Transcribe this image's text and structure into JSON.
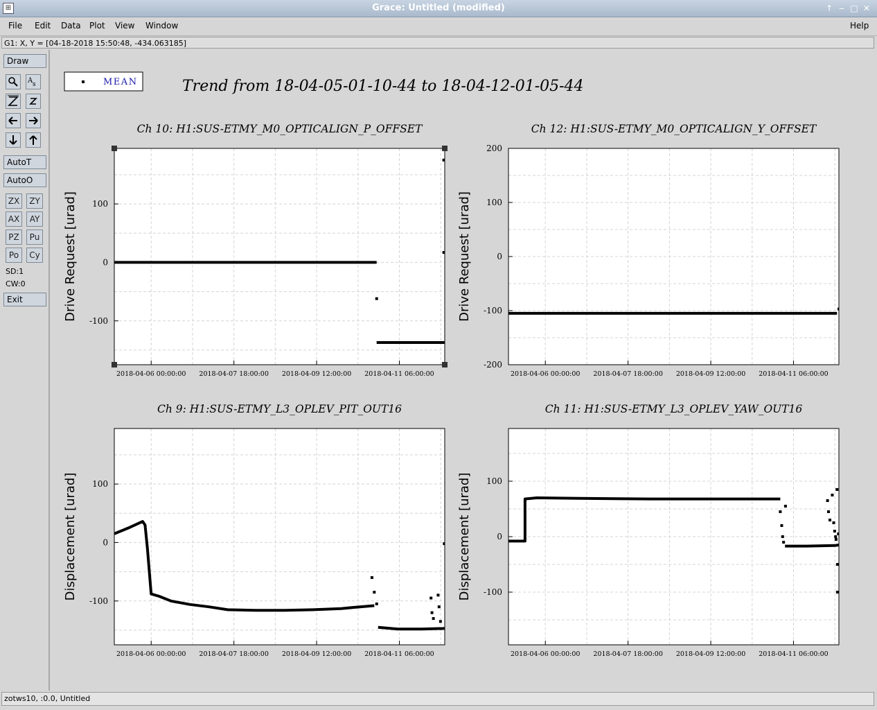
{
  "window": {
    "title": "Grace: Untitled (modified)"
  },
  "menubar": {
    "file": "File",
    "edit": "Edit",
    "data": "Data",
    "plot": "Plot",
    "view": "View",
    "window": "Window",
    "help": "Help"
  },
  "coord_readout": "G1: X, Y = [04-18-2018 15:50:48, -434.063185]",
  "toolbar": {
    "draw": "Draw",
    "autot": "AutoT",
    "autoo": "AutoO",
    "zx": "ZX",
    "zy": "ZY",
    "ax": "AX",
    "ay": "AY",
    "pz": "PZ",
    "pu": "Pu",
    "po": "Po",
    "cy": "Cy",
    "sd": "SD:1",
    "cw": "CW:0",
    "exit": "Exit"
  },
  "status": "zotws10, :0.0, Untitled",
  "legend": {
    "label": "MEAN"
  },
  "main_title": "Trend from 18-04-05-01-10-44 to 18-04-12-01-05-44",
  "chart_data": [
    {
      "type": "line",
      "title": "Ch 10: H1:SUS-ETMY_M0_OPTICALIGN_P_OFFSET",
      "ylabel": "Drive Request [urad]",
      "xticks": [
        "2018-04-06 00:00:00",
        "2018-04-07 18:00:00",
        "2018-04-09 12:00:00",
        "2018-04-11 06:00:00"
      ],
      "yticks": [
        -100,
        0,
        100
      ],
      "ylim": [
        -175,
        195
      ],
      "xlim": [
        0,
        6.99
      ],
      "x_unit": "days since 2018-04-05 01:10:44",
      "series": [
        {
          "name": "MEAN",
          "segments": [
            [
              [
                0,
                0
              ],
              [
                5.55,
                0
              ]
            ],
            [
              [
                5.55,
                -137
              ],
              [
                6.99,
                -137
              ]
            ]
          ],
          "points": [
            [
              5.55,
              -62
            ],
            [
              6.97,
              175
            ],
            [
              6.97,
              17
            ]
          ]
        }
      ]
    },
    {
      "type": "line",
      "title": "Ch 12: H1:SUS-ETMY_M0_OPTICALIGN_Y_OFFSET",
      "ylabel": "Drive Request [urad]",
      "xticks": [
        "2018-04-06 00:00:00",
        "2018-04-07 18:00:00",
        "2018-04-09 12:00:00",
        "2018-04-11 06:00:00"
      ],
      "yticks": [
        -200,
        -100,
        0,
        100,
        200
      ],
      "ylim": [
        -200,
        200
      ],
      "xlim": [
        0,
        6.99
      ],
      "series": [
        {
          "name": "MEAN",
          "segments": [
            [
              [
                0,
                -105
              ],
              [
                6.95,
                -105
              ]
            ]
          ],
          "points": [
            [
              6.99,
              -97
            ]
          ]
        }
      ]
    },
    {
      "type": "line",
      "title": "Ch 9: H1:SUS-ETMY_L3_OPLEV_PIT_OUT16",
      "ylabel": "Displacement [urad]",
      "xticks": [
        "2018-04-06 00:00:00",
        "2018-04-07 18:00:00",
        "2018-04-09 12:00:00",
        "2018-04-11 06:00:00"
      ],
      "yticks": [
        -100,
        0,
        100
      ],
      "ylim": [
        -175,
        195
      ],
      "xlim": [
        0,
        6.99
      ],
      "series": [
        {
          "name": "MEAN",
          "segments": [
            [
              [
                0,
                15
              ],
              [
                0.3,
                25
              ],
              [
                0.6,
                36
              ],
              [
                0.65,
                30
              ],
              [
                0.7,
                -10
              ],
              [
                0.78,
                -88
              ],
              [
                0.95,
                -92
              ],
              [
                1.2,
                -100
              ],
              [
                1.6,
                -106
              ],
              [
                2.0,
                -110
              ],
              [
                2.4,
                -115
              ],
              [
                3.0,
                -116
              ],
              [
                3.6,
                -116
              ],
              [
                4.2,
                -115
              ],
              [
                4.8,
                -113
              ],
              [
                5.2,
                -110
              ],
              [
                5.5,
                -108
              ]
            ],
            [
              [
                5.58,
                -145
              ],
              [
                6.0,
                -148
              ],
              [
                6.5,
                -148
              ],
              [
                6.99,
                -147
              ]
            ]
          ],
          "points": [
            [
              5.45,
              -60
            ],
            [
              5.5,
              -85
            ],
            [
              5.55,
              -105
            ],
            [
              6.7,
              -95
            ],
            [
              6.72,
              -120
            ],
            [
              6.75,
              -130
            ],
            [
              6.85,
              -90
            ],
            [
              6.87,
              -110
            ],
            [
              6.9,
              -135
            ],
            [
              6.98,
              -2
            ]
          ]
        }
      ]
    },
    {
      "type": "line",
      "title": "Ch 11: H1:SUS-ETMY_L3_OPLEV_YAW_OUT16",
      "ylabel": "Displacement [urad]",
      "xticks": [
        "2018-04-06 00:00:00",
        "2018-04-07 18:00:00",
        "2018-04-09 12:00:00",
        "2018-04-11 06:00:00"
      ],
      "yticks": [
        -100,
        0,
        100
      ],
      "ylim": [
        -195,
        195
      ],
      "xlim": [
        0,
        6.99
      ],
      "series": [
        {
          "name": "MEAN",
          "segments": [
            [
              [
                0,
                -8
              ],
              [
                0.35,
                -8
              ],
              [
                0.35,
                68
              ],
              [
                0.6,
                70
              ],
              [
                1.5,
                69
              ],
              [
                3.0,
                68
              ],
              [
                5.75,
                68
              ]
            ],
            [
              [
                5.85,
                -17
              ],
              [
                6.3,
                -17
              ],
              [
                6.9,
                -16
              ],
              [
                6.99,
                -15
              ]
            ]
          ],
          "points": [
            [
              5.75,
              45
            ],
            [
              5.78,
              20
            ],
            [
              5.8,
              0
            ],
            [
              5.82,
              -10
            ],
            [
              5.86,
              55
            ],
            [
              6.75,
              65
            ],
            [
              6.77,
              45
            ],
            [
              6.8,
              30
            ],
            [
              6.85,
              75
            ],
            [
              6.88,
              25
            ],
            [
              6.9,
              10
            ],
            [
              6.92,
              0
            ],
            [
              6.93,
              -5
            ],
            [
              6.95,
              85
            ],
            [
              6.96,
              -50
            ],
            [
              6.96,
              -100
            ],
            [
              6.98,
              5
            ]
          ]
        }
      ]
    }
  ]
}
